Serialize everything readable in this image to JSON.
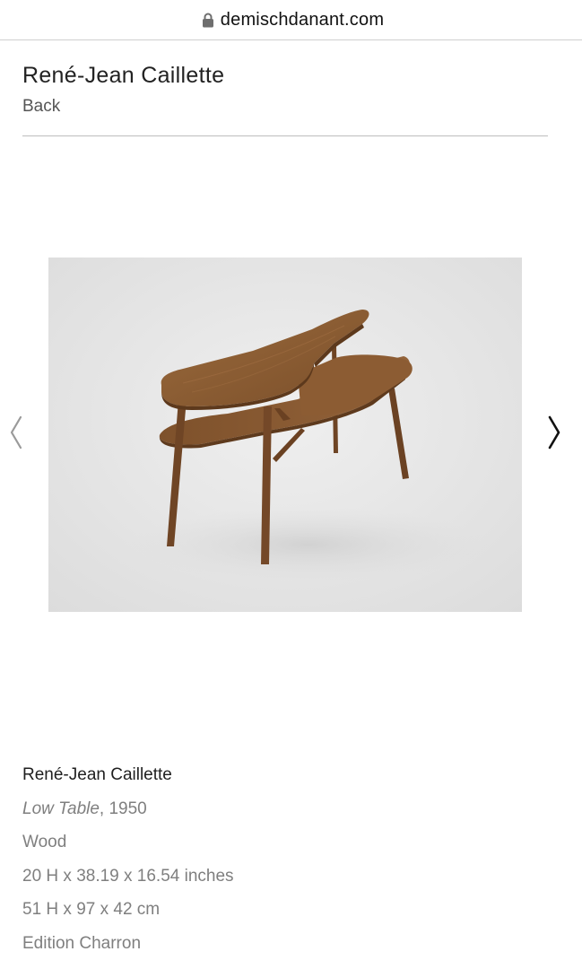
{
  "browser": {
    "url": "demischdanant.com"
  },
  "header": {
    "title": "René-Jean Caillette",
    "back_label": "Back"
  },
  "gallery": {
    "prev_icon": "chevron-left-icon",
    "next_icon": "chevron-right-icon",
    "image_subject": "product-photo"
  },
  "details": {
    "artist": "René-Jean Caillette",
    "title": "Low Table",
    "year_suffix": ", 1950",
    "material": "Wood",
    "dimensions_in": "20 H x 38.19 x 16.54 inches",
    "dimensions_cm": "51 H x 97 x 42 cm",
    "edition": "Edition Charron"
  },
  "colors": {
    "wood": "#8a5a30",
    "background_photo": "#e7e7e7",
    "divider": "#bdbdbd",
    "meta_text": "#7f7f7f"
  }
}
